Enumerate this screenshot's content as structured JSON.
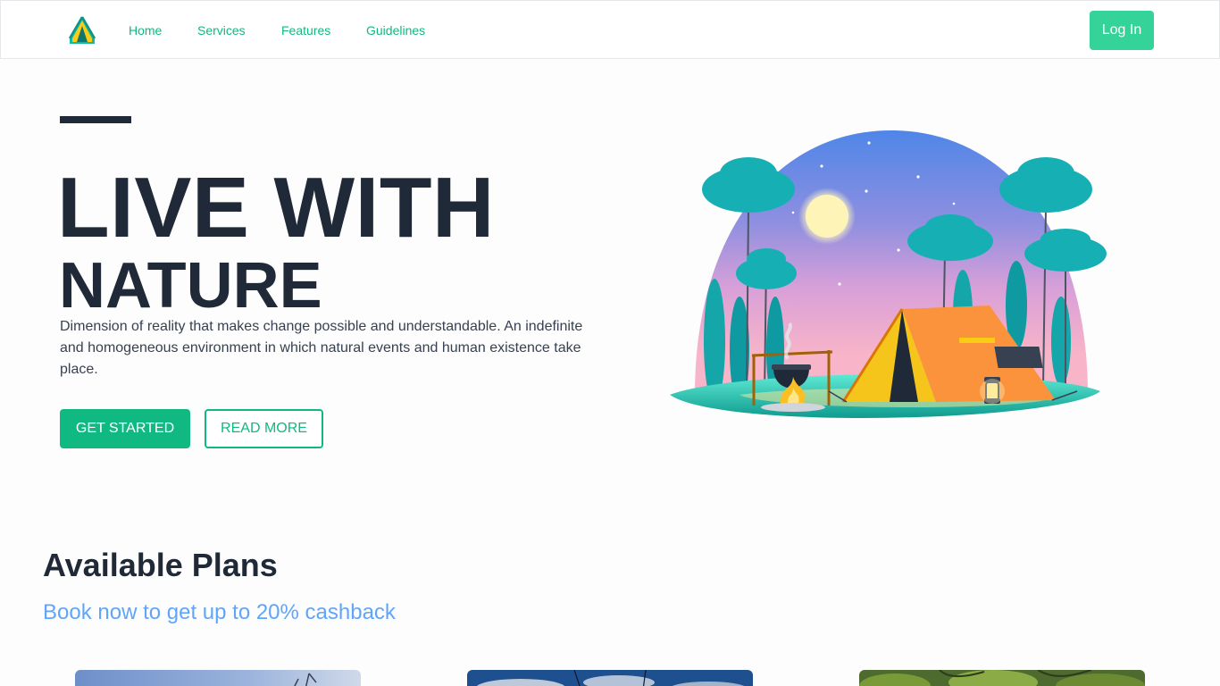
{
  "nav": {
    "logo_icon": "tent-logo-icon",
    "links": [
      "Home",
      "Services",
      "Features",
      "Guidelines"
    ],
    "login_label": "Log In"
  },
  "hero": {
    "title_line1": "LIVE WITH",
    "title_line2": "NATURE",
    "description": "Dimension of reality that makes change possible and understandable. An indefinite and homogeneous environment in which natural events and human existence take place.",
    "primary_button": "GET STARTED",
    "secondary_button": "READ MORE",
    "illustration_icon": "camping-illustration"
  },
  "plans": {
    "title": "Available Plans",
    "subtitle": "Book now to get up to 20% cashback",
    "cards": [
      {
        "image_icon": "mountain-landscape-image"
      },
      {
        "image_icon": "cloudy-sky-image"
      },
      {
        "image_icon": "forest-trees-image"
      }
    ]
  },
  "colors": {
    "accent": "#10b981",
    "accent_light": "#34d399",
    "subtitle_blue": "#60a5fa",
    "text_dark": "#1f2937"
  }
}
